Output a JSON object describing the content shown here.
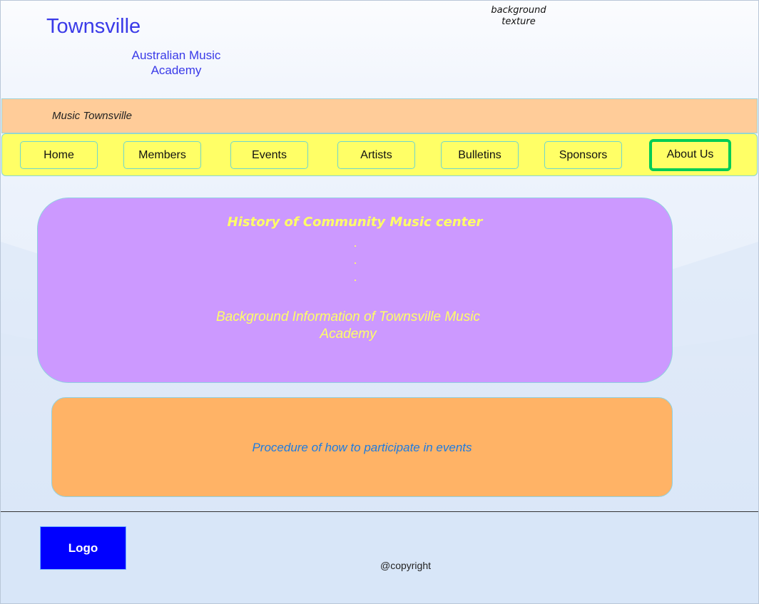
{
  "header": {
    "title": "Townsville",
    "subtitle": "Australian Music Academy",
    "background_note": "background texture"
  },
  "tagline": "Music Townsville",
  "nav": {
    "items": [
      "Home",
      "Members",
      "Events",
      "Artists",
      "Bulletins",
      "Sponsors",
      "About Us"
    ],
    "active": "About Us"
  },
  "history_card": {
    "title": "History of Community Music center",
    "dots": [
      ".",
      ".",
      "."
    ],
    "info": "Background Information of Townsville Music Academy"
  },
  "procedure_card": {
    "text": "Procedure of how to participate in events"
  },
  "footer": {
    "logo": "Logo",
    "copyright": "@copyright"
  },
  "colors": {
    "title_blue": "#3a3ae8",
    "tagline_bar": "#ffcc99",
    "nav_bar": "#ffff66",
    "active_border": "#00cc55",
    "history_card": "#cc99ff",
    "history_text": "#ffff66",
    "procedure_card": "#ffb366",
    "procedure_text": "#1e7be0",
    "logo_box": "#0000ff"
  }
}
